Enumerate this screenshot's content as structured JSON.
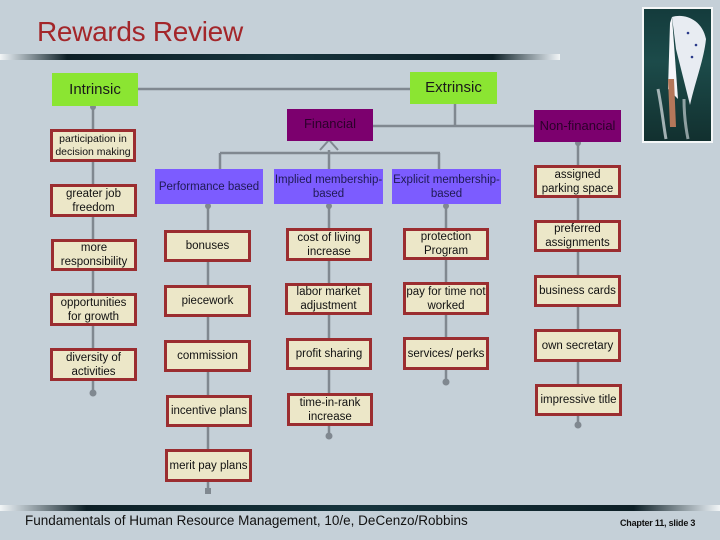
{
  "slide": {
    "title": "Rewards Review",
    "footer_left": "Fundamentals of Human Resource Management, 10/e, DeCenzo/Robbins",
    "footer_right": "Chapter 11, slide 3",
    "photo": "sailboat-photo"
  },
  "colors": {
    "title": "#a3262a",
    "category_green": "#8be532",
    "category_purple": "#7c006e",
    "subcategory_violet": "#7c5cff",
    "leaf_fill": "#ece7c8",
    "leaf_border": "#9b2d30",
    "connector": "#808890",
    "background": "#c5d0d8"
  },
  "diagram": {
    "intrinsic": {
      "label": "Intrinsic",
      "items": [
        "participation in decision making",
        "greater job freedom",
        "more responsibility",
        "opportunities for growth",
        "diversity of activities"
      ]
    },
    "extrinsic": {
      "label": "Extrinsic",
      "financial": {
        "label": "Financial",
        "performance_based": {
          "label": "Performance based",
          "items": [
            "bonuses",
            "piecework",
            "commission",
            "incentive plans",
            "merit pay plans"
          ]
        },
        "implied_membership": {
          "label": "Implied membership-based",
          "items": [
            "cost of living increase",
            "labor market adjustment",
            "profit sharing",
            "time-in-rank increase"
          ]
        },
        "explicit_membership": {
          "label": "Explicit membership-based",
          "items": [
            "protection Program",
            "pay for time not worked",
            "services/ perks"
          ]
        }
      },
      "non_financial": {
        "label": "Non-financial",
        "items": [
          "assigned parking space",
          "preferred assignments",
          "business cards",
          "own secretary",
          "impressive title"
        ]
      }
    }
  }
}
